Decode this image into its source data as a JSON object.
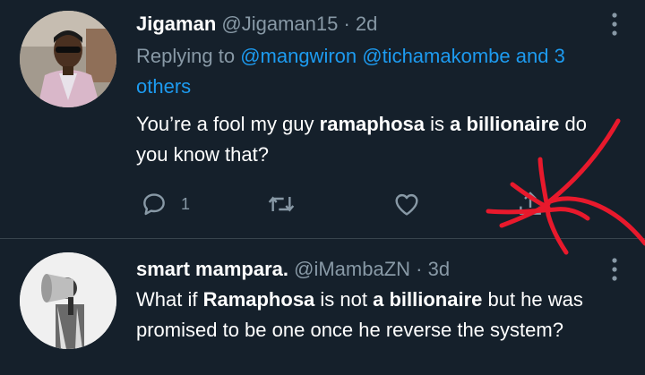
{
  "tweets": [
    {
      "name": "Jigaman",
      "handle": "@Jigaman15",
      "sep": " · ",
      "time": "2d",
      "replying_prefix": "Replying to ",
      "replying_mentions": "@mangwiron @tichamakombe and 3 others",
      "text_parts": [
        "You’re a fool my guy ",
        "ramaphosa",
        " is ",
        "a billionaire",
        " do you know that?"
      ],
      "reply_count": "1"
    },
    {
      "name": "smart mampara.",
      "handle": "@iMambaZN",
      "sep": " · ",
      "time": "3d",
      "text_parts": [
        "What if ",
        "Ramaphosa",
        " is not ",
        "a billionaire",
        " but he was promised to be one once he reverse the system?"
      ]
    }
  ],
  "colors": {
    "background": "#15202b",
    "secondary_text": "#8899a6",
    "link": "#1d9bf0",
    "annotation": "#e8192c"
  },
  "icons": [
    "reply-icon",
    "retweet-icon",
    "like-icon",
    "share-icon",
    "more-icon"
  ]
}
